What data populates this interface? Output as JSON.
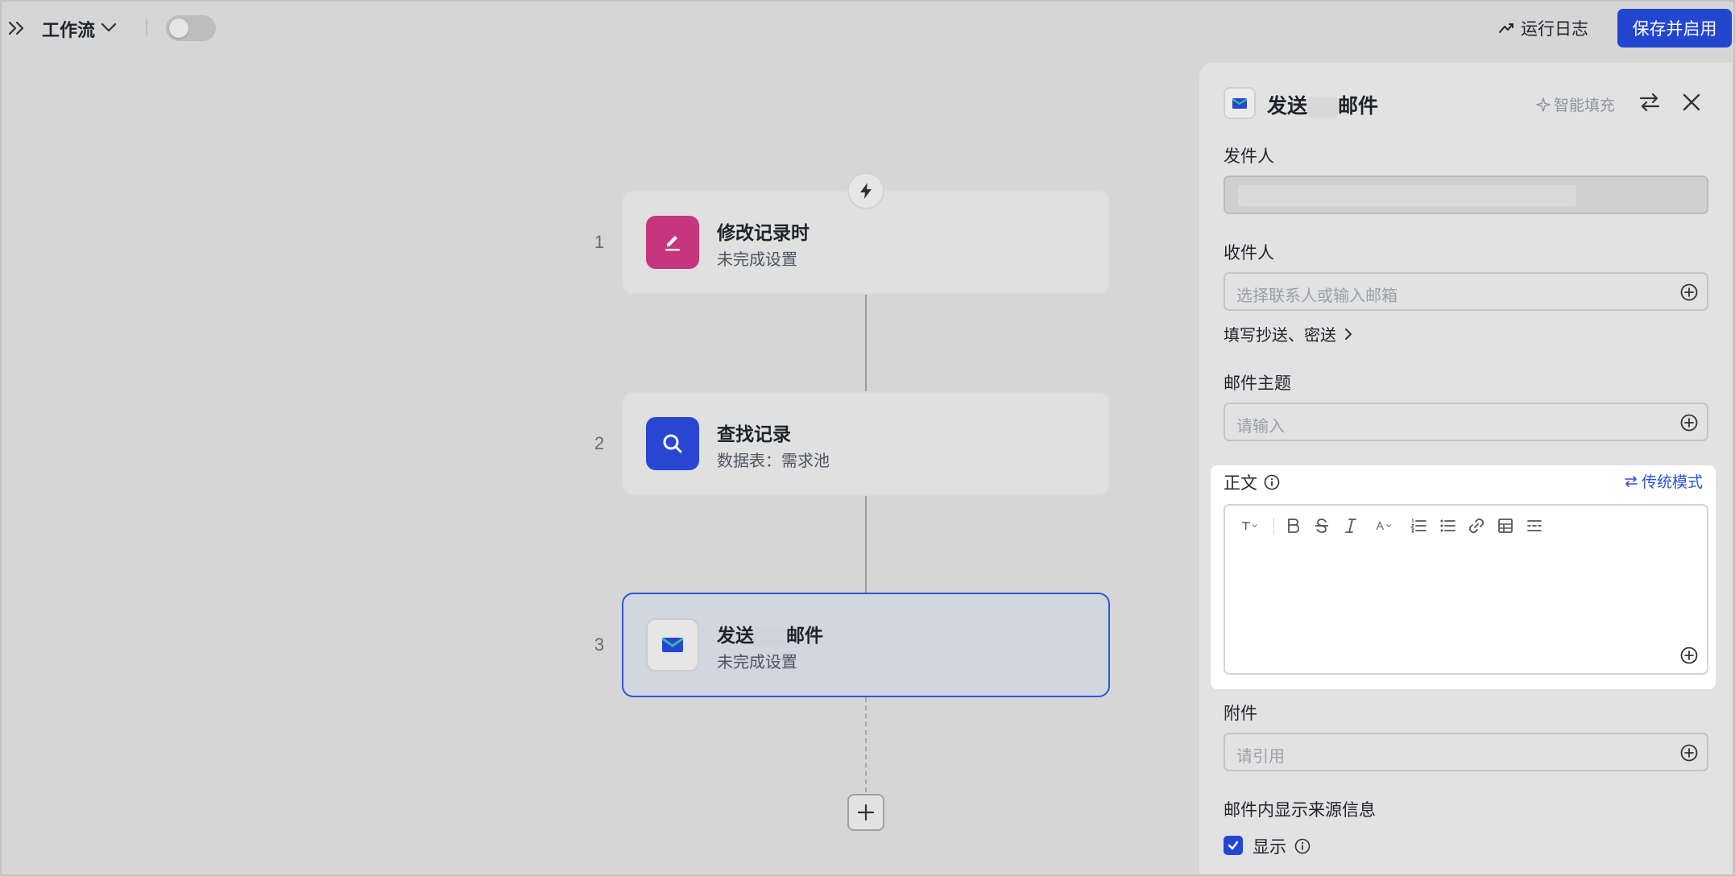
{
  "topbar": {
    "title": "工作流",
    "run_log": "运行日志",
    "save_label": "保存并启用"
  },
  "flow": {
    "nodes": [
      {
        "num": "1",
        "title": "修改记录时",
        "subtitle": "未完成设置",
        "icon": "edit-icon"
      },
      {
        "num": "2",
        "title": "查找记录",
        "subtitle": "数据表：需求池",
        "icon": "search-icon"
      },
      {
        "num": "3",
        "title_a": "发送",
        "title_b": "邮件",
        "subtitle": "未完成设置",
        "icon": "mail-icon"
      }
    ]
  },
  "panel": {
    "title_a": "发送",
    "title_b": "邮件",
    "smart_fill": "智能填充",
    "sender_label": "发件人",
    "recipient_label": "收件人",
    "recipient_placeholder": "选择联系人或输入邮箱",
    "cc_bcc": "填写抄送、密送",
    "subject_label": "邮件主题",
    "subject_placeholder": "请输入",
    "body_label": "正文",
    "legacy_mode": "传统模式",
    "attachment_label": "附件",
    "attachment_placeholder": "请引用",
    "source_info_label": "邮件内显示来源信息",
    "show_label": "显示"
  },
  "colors": {
    "primary": "#2346d1",
    "edit_node": "#c5367f",
    "search_node": "#2846d2",
    "active_border": "#2f55d4"
  }
}
